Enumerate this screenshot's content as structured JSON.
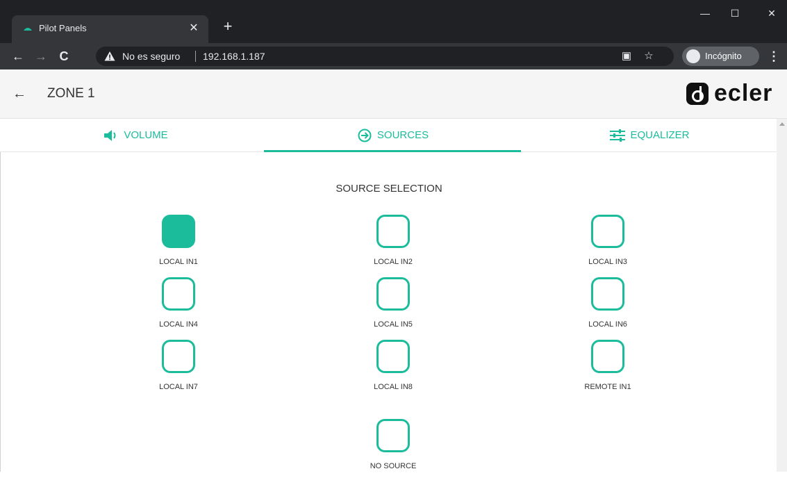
{
  "browser": {
    "tab_title": "Pilot Panels",
    "tab_close": "✕",
    "new_tab": "+",
    "window": {
      "minimize": "—",
      "maximize": "☐",
      "close": "✕"
    },
    "security_text": "No es seguro",
    "url": "192.168.1.187",
    "incognito_label": "Incógnito"
  },
  "header": {
    "back_glyph": "←",
    "title": "ZONE 1",
    "logo_text": "ecler"
  },
  "tabs": [
    {
      "label": "VOLUME",
      "icon": "speaker-icon",
      "active": false
    },
    {
      "label": "SOURCES",
      "icon": "input-arrow-icon",
      "active": true
    },
    {
      "label": "EQUALIZER",
      "icon": "sliders-icon",
      "active": false
    }
  ],
  "main": {
    "section_title": "SOURCE SELECTION",
    "sources": [
      {
        "label": "LOCAL IN1",
        "selected": true
      },
      {
        "label": "LOCAL IN2",
        "selected": false
      },
      {
        "label": "LOCAL IN3",
        "selected": false
      },
      {
        "label": "LOCAL IN4",
        "selected": false
      },
      {
        "label": "LOCAL IN5",
        "selected": false
      },
      {
        "label": "LOCAL IN6",
        "selected": false
      },
      {
        "label": "LOCAL IN7",
        "selected": false
      },
      {
        "label": "LOCAL IN8",
        "selected": false
      },
      {
        "label": "REMOTE IN1",
        "selected": false
      },
      {
        "label": "NO SOURCE",
        "selected": false
      }
    ]
  },
  "colors": {
    "accent": "#1abc9c",
    "chrome_dark": "#202124",
    "chrome_toolbar": "#35363a"
  }
}
